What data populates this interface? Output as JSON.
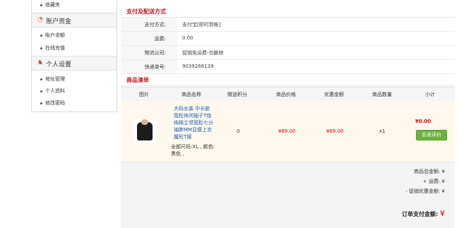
{
  "sidebar": {
    "top_item": "收藏夹",
    "account_section": {
      "title": "账户资金",
      "items": [
        "账户余额",
        "在线充值"
      ]
    },
    "personal_section": {
      "title": "个人设置",
      "items": [
        "地址管理",
        "个人资料",
        "修改密码"
      ]
    }
  },
  "payment": {
    "section_title": "支付及配送方式",
    "rows": [
      {
        "label": "支付方式:",
        "value": "支付宝[即时到帐]"
      },
      {
        "label": "运费:",
        "value": "0.00"
      },
      {
        "label": "物流公司:",
        "value": "促销免运费-勿删除"
      },
      {
        "label": "快递单号:",
        "value": "9039266139"
      }
    ]
  },
  "products": {
    "section_title": "商品清单",
    "columns": [
      "图片",
      "商品名称",
      "赠送积分",
      "商品价格",
      "优惠金额",
      "商品数量",
      "小计"
    ],
    "rows": [
      {
        "name": "大码女装 中长款宽松休闲袖子T恤纯棉立领宽松七分袖胖MM显瘦上衣 魔形T摆",
        "spec": "全部尺码:XL , 颜色:黑色 ,",
        "points": "0",
        "price": "¥69.00",
        "discount": "¥69.00",
        "quantity": "x1",
        "subtotal": "¥0.00",
        "review_label": "去发评价"
      }
    ]
  },
  "summary": {
    "goods_total": "商品总金额: ¥",
    "shipping": "+ 运费: ¥",
    "promo": "- 促销优惠金额: ¥",
    "payable_label": "订单支付金额:",
    "payable_currency": "¥"
  },
  "colors": {
    "accent_red": "#c0171b",
    "price_red": "#d6000f",
    "review_green": "#6cb33e",
    "link_blue": "#1a59b7"
  }
}
